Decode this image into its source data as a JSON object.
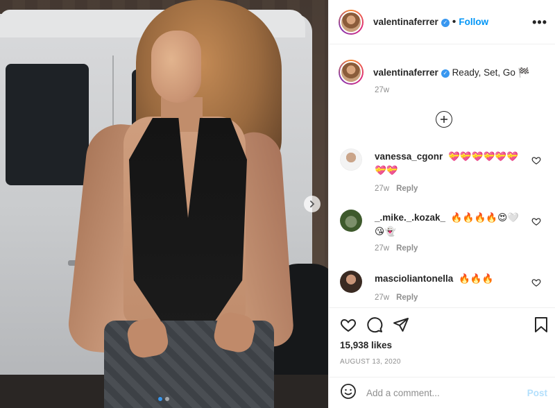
{
  "post": {
    "username": "valentinaferrer",
    "follow_label": "Follow",
    "separator": "•",
    "more_label": "•••",
    "caption_text": "Ready, Set, Go ",
    "caption_emoji": "🏁",
    "caption_time": "27w",
    "likes": "15,938 likes",
    "date": "AUGUST 13, 2020"
  },
  "comments": [
    {
      "username": "vanessa_cgonr",
      "text": "💝💝💝💝💝💝💝💝",
      "time": "27w",
      "reply_label": "Reply"
    },
    {
      "username": "_.mike._.kozak_",
      "text": "🔥🔥🔥🔥😍🤍😘👻",
      "time": "27w",
      "reply_label": "Reply"
    },
    {
      "username": "mascioliantonella",
      "text": "🔥🔥🔥",
      "time": "27w",
      "reply_label": "Reply"
    }
  ],
  "composer": {
    "placeholder": "Add a comment...",
    "post_label": "Post"
  },
  "colors": {
    "accent": "#0095f6",
    "verified": "#3897f0",
    "post_disabled": "#b2dffc",
    "muted": "#8e8e8e"
  },
  "carousel": {
    "total_slides": 2,
    "active_slide": 1
  }
}
